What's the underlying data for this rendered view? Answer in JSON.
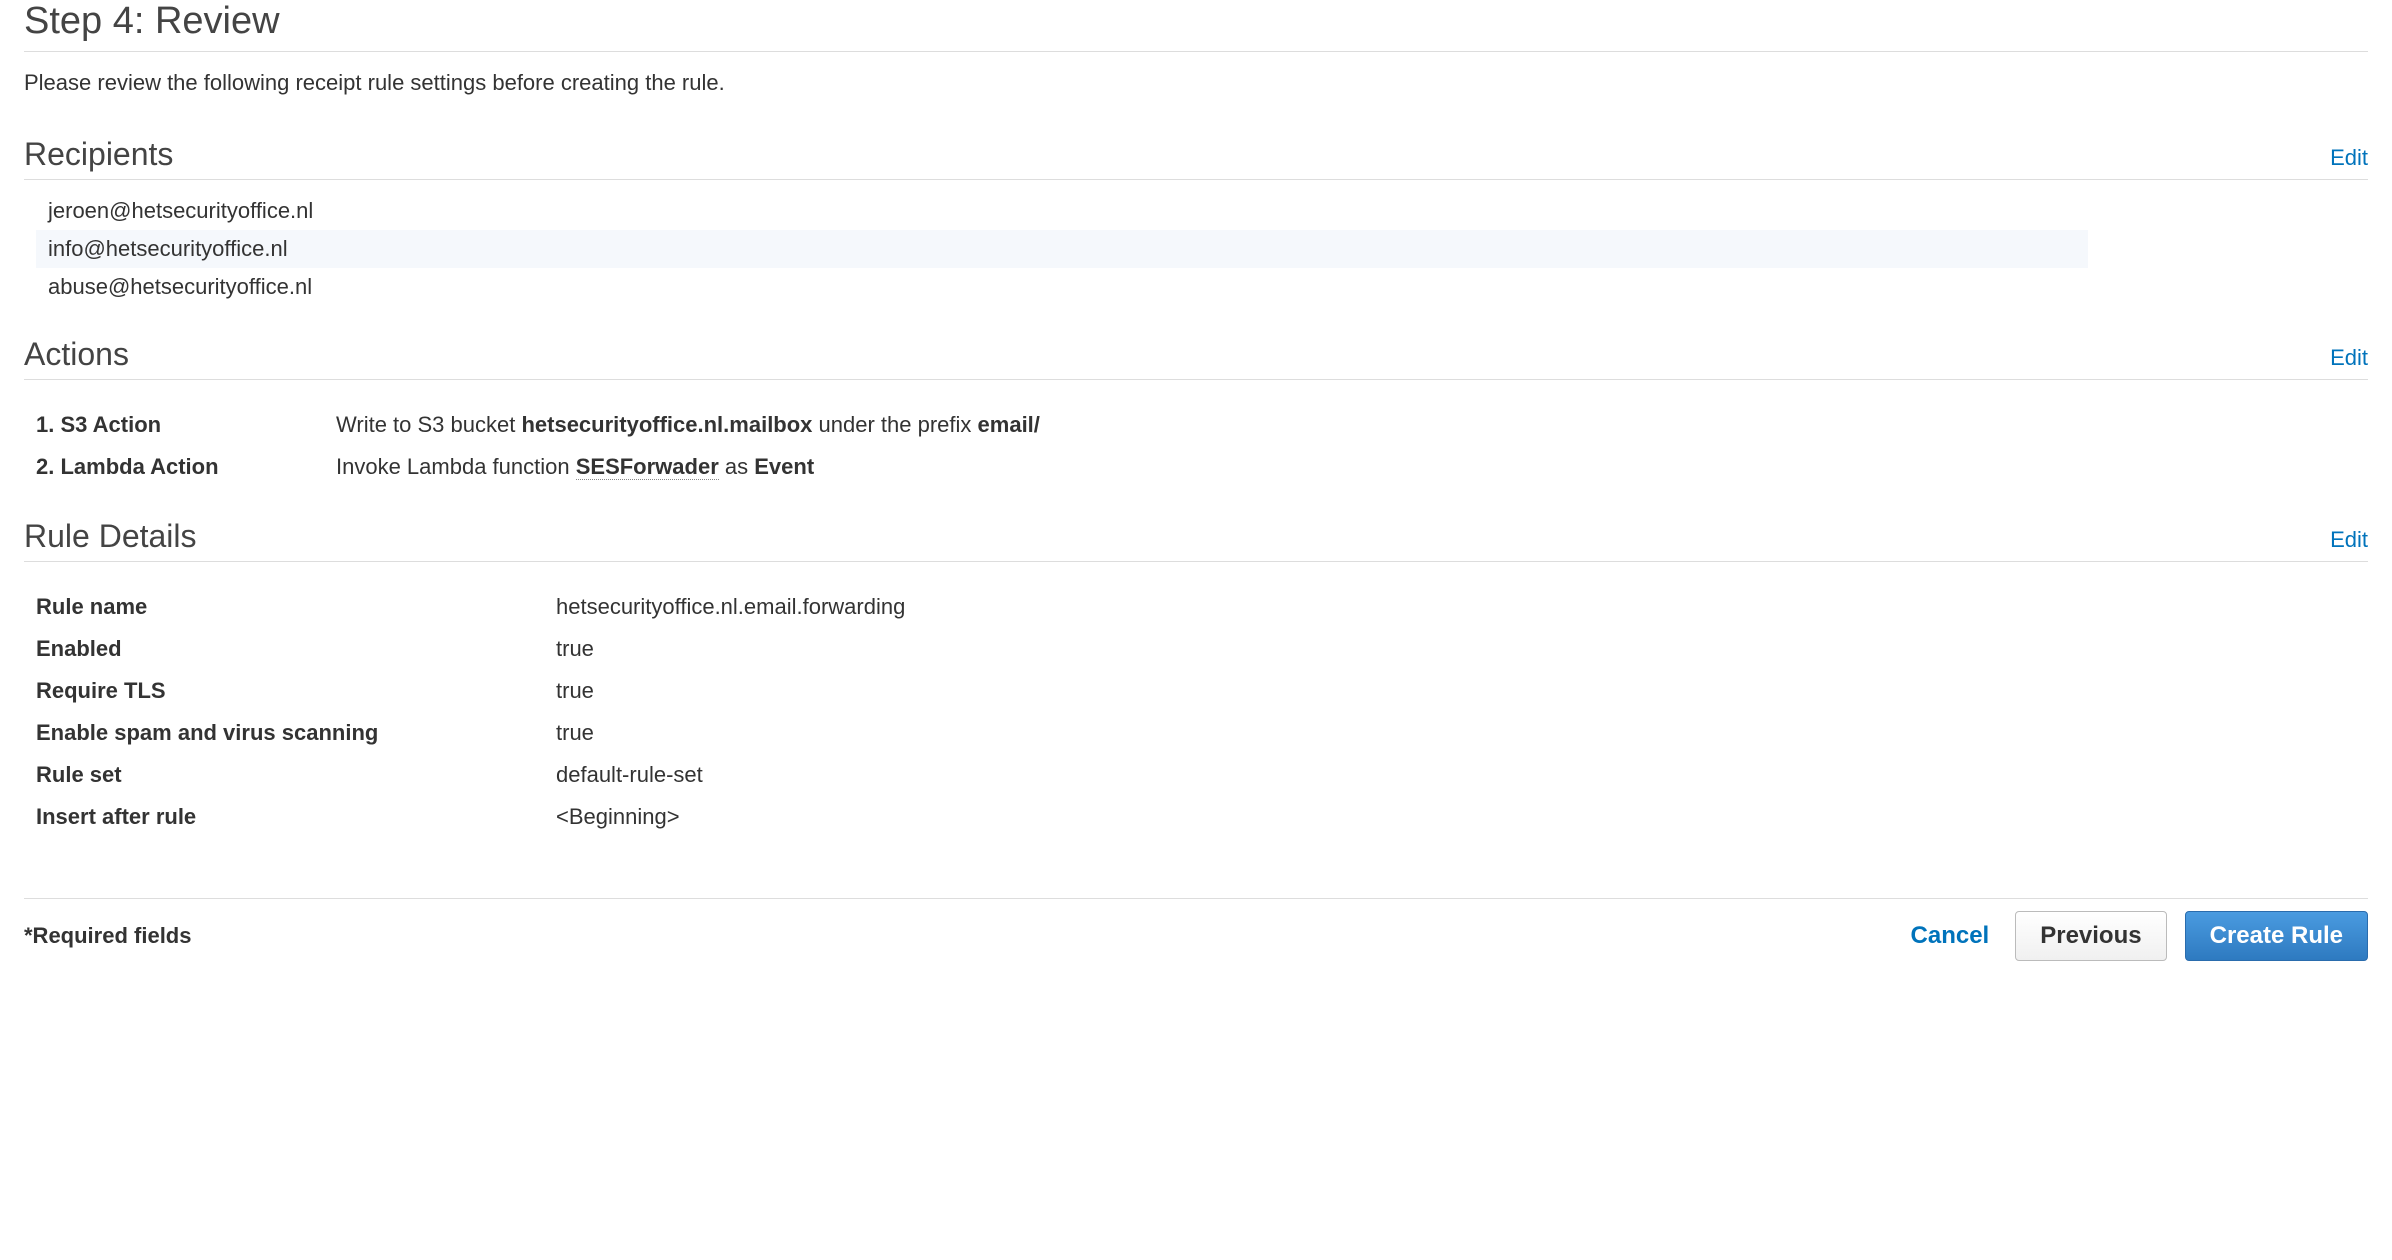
{
  "header": {
    "title": "Step 4: Review",
    "intro": "Please review the following receipt rule settings before creating the rule."
  },
  "sections": {
    "recipients": {
      "title": "Recipients",
      "edit": "Edit",
      "items": [
        "jeroen@hetsecurityoffice.nl",
        "info@hetsecurityoffice.nl",
        "abuse@hetsecurityoffice.nl"
      ]
    },
    "actions": {
      "title": "Actions",
      "edit": "Edit",
      "items": [
        {
          "label": "1. S3 Action",
          "prefix": "Write to S3 bucket ",
          "bold1": "hetsecurityoffice.nl.mailbox",
          "mid": " under the prefix ",
          "bold2": "email/"
        },
        {
          "label": "2. Lambda Action",
          "prefix": "Invoke Lambda function ",
          "dotted": "SESForwader",
          "mid": " as ",
          "bold2": "Event"
        }
      ]
    },
    "details": {
      "title": "Rule Details",
      "edit": "Edit",
      "rows": [
        {
          "label": "Rule name",
          "value": "hetsecurityoffice.nl.email.forwarding"
        },
        {
          "label": "Enabled",
          "value": "true"
        },
        {
          "label": "Require TLS",
          "value": "true"
        },
        {
          "label": "Enable spam and virus scanning",
          "value": "true"
        },
        {
          "label": "Rule set",
          "value": "default-rule-set"
        },
        {
          "label": "Insert after rule",
          "value": "<Beginning>"
        }
      ]
    }
  },
  "footer": {
    "required": "*Required fields",
    "cancel": "Cancel",
    "previous": "Previous",
    "create": "Create Rule"
  }
}
